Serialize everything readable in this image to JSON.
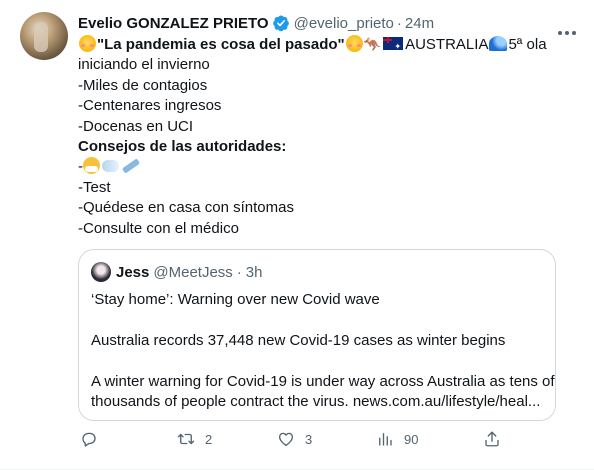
{
  "tweet": {
    "author_name": "Evelio GONZALEZ PRIETO",
    "handle": "@evelio_prieto",
    "separator": "·",
    "time": "24m",
    "line1_quote": "\"La pandemia es cosa del pasado\"",
    "line1_country": "AUSTRALIA",
    "line1_tail": "5ª ola",
    "line2": "iniciando el invierno",
    "line3": "-Miles de contagios",
    "line4": "-Centenares ingresos",
    "line5": "-Docenas en UCI",
    "line6": "Consejos de las autoridades:",
    "line7_prefix": "-",
    "line8": "-Test",
    "line9": "-Quédese en casa con síntomas",
    "line10": "-Consulte con el médico"
  },
  "quoted_tweet": {
    "author_name": "Jess",
    "handle": "@MeetJess",
    "separator": "·",
    "time": "3h",
    "line1": "‘Stay home’: Warning over new Covid wave",
    "line2": "Australia records 37,448 new Covid-19 cases as winter begins",
    "line3": "A winter warning for Covid-19 is under way across Australia as tens of",
    "line4": "thousands of people contract the virus. news.com.au/lifestyle/heal..."
  },
  "actions": {
    "reply_count": "",
    "retweet_count": "2",
    "like_count": "3",
    "views_count": "90"
  },
  "icons": {
    "reply": "reply-icon",
    "retweet": "retweet-icon",
    "like": "heart-icon",
    "views": "views-icon",
    "share": "share-icon",
    "verified": "verified-badge-icon",
    "more": "more-icon"
  },
  "colors": {
    "text": "#0f1419",
    "secondary": "#536471",
    "verified": "#1d9bf0",
    "border": "#cfd9de"
  }
}
